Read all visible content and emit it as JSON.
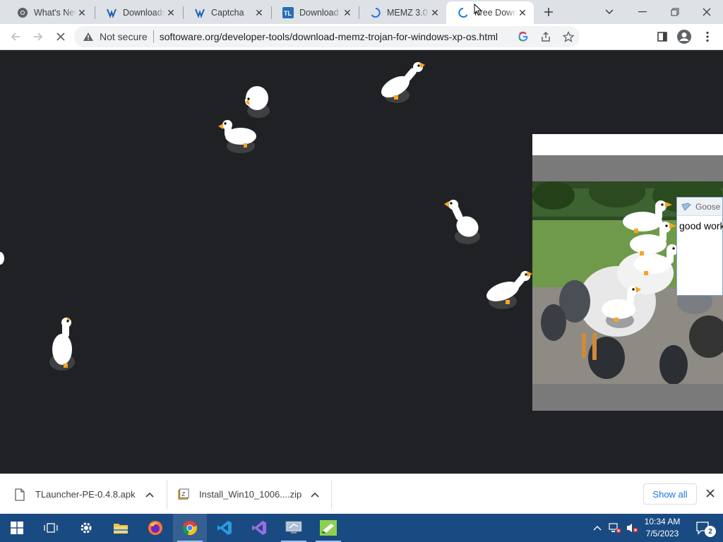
{
  "browser": {
    "tabs": [
      {
        "title": "What's New",
        "favicon": "chrome-icon"
      },
      {
        "title": "Downloads",
        "favicon": "softoware-icon"
      },
      {
        "title": "Captcha",
        "favicon": "softoware-icon"
      },
      {
        "title": "Download",
        "favicon": "tlauncher-icon"
      },
      {
        "title": "MEMZ 3.0",
        "favicon": "loading-spinner-icon"
      },
      {
        "title": "Free Down",
        "favicon": "loading-spinner-icon",
        "active": true
      }
    ],
    "omnibox": {
      "security_label": "Not secure",
      "url": "softoware.org/developer-tools/download-memz-trojan-for-windows-xp-os.html"
    }
  },
  "page": {
    "goose_window": {
      "title": "Goose",
      "message": "good work"
    }
  },
  "download_bar": {
    "items": [
      {
        "filename": "TLauncher-PE-0.4.8.apk",
        "icon": "file-icon"
      },
      {
        "filename": "Install_Win10_1006....zip",
        "icon": "zip-archive-icon"
      }
    ],
    "show_all_label": "Show all"
  },
  "taskbar": {
    "apps": [
      "start-icon",
      "task-view-icon",
      "settings-icon",
      "file-explorer-icon",
      "firefox-icon",
      "chrome-icon",
      "vscode-icon",
      "visual-studio-icon",
      "remote-desktop-icon",
      "notepad-icon"
    ],
    "clock": {
      "time": "10:34 AM",
      "date": "7/5/2023"
    },
    "notification_count": "2"
  },
  "colors": {
    "taskbar": "#1a4a82",
    "page_background": "#202124",
    "tabstrip": "#dee1e6",
    "link_blue": "#1a73e8"
  }
}
